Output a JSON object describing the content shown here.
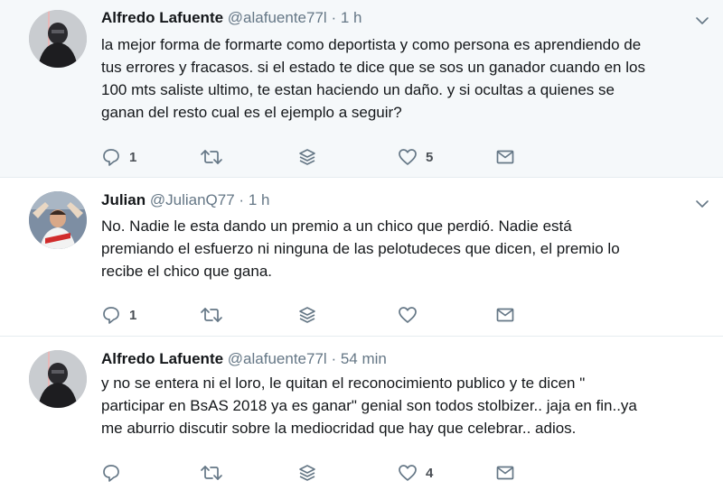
{
  "tweets": [
    {
      "name": "Alfredo Lafuente",
      "handle": "@alafuente77l",
      "separator": "·",
      "time": "1 h",
      "lines": [
        "la mejor forma de formarte como deportista y como persona es aprendiendo de",
        "tus errores y fracasos. si el estado te dice que se sos un ganador cuando en los",
        "100 mts saliste ultimo, te estan haciendo un daño. y si ocultas a quienes se",
        "ganan del resto cual es el ejemplo a seguir?"
      ],
      "reply_count": "1",
      "retweet_count": "",
      "like_count": "5"
    },
    {
      "name": "Julian",
      "handle": "@JulianQ77",
      "separator": "·",
      "time": "1 h",
      "lines": [
        "No. Nadie le esta dando un premio a un chico que perdió. Nadie está",
        "premiando el esfuerzo ni ninguna de las pelotudeces que dicen, el premio lo",
        "recibe el chico que gana."
      ],
      "reply_count": "1",
      "retweet_count": "",
      "like_count": ""
    },
    {
      "name": "Alfredo Lafuente",
      "handle": "@alafuente77l",
      "separator": "·",
      "time": "54 min",
      "lines": [
        "y no se entera ni el loro, le quitan el reconocimiento publico y te dicen \"",
        "participar en BsAS 2018 ya es ganar\" genial son todos stolbizer.. jaja en fin..ya",
        "me aburrio discutir sobre la mediocridad que hay que celebrar.. adios."
      ],
      "reply_count": "",
      "retweet_count": "",
      "like_count": "4"
    }
  ],
  "icons": {
    "reply": "reply-icon",
    "retweet": "retweet-icon",
    "stack": "stack-icon",
    "like": "heart-icon",
    "dm": "envelope-icon",
    "caret": "chevron-down-icon"
  },
  "colors": {
    "highlight_bg": "#f5f8fa",
    "icon": "#657786",
    "name": "#14171a",
    "meta": "#657786",
    "divider": "#e6ecf0"
  }
}
